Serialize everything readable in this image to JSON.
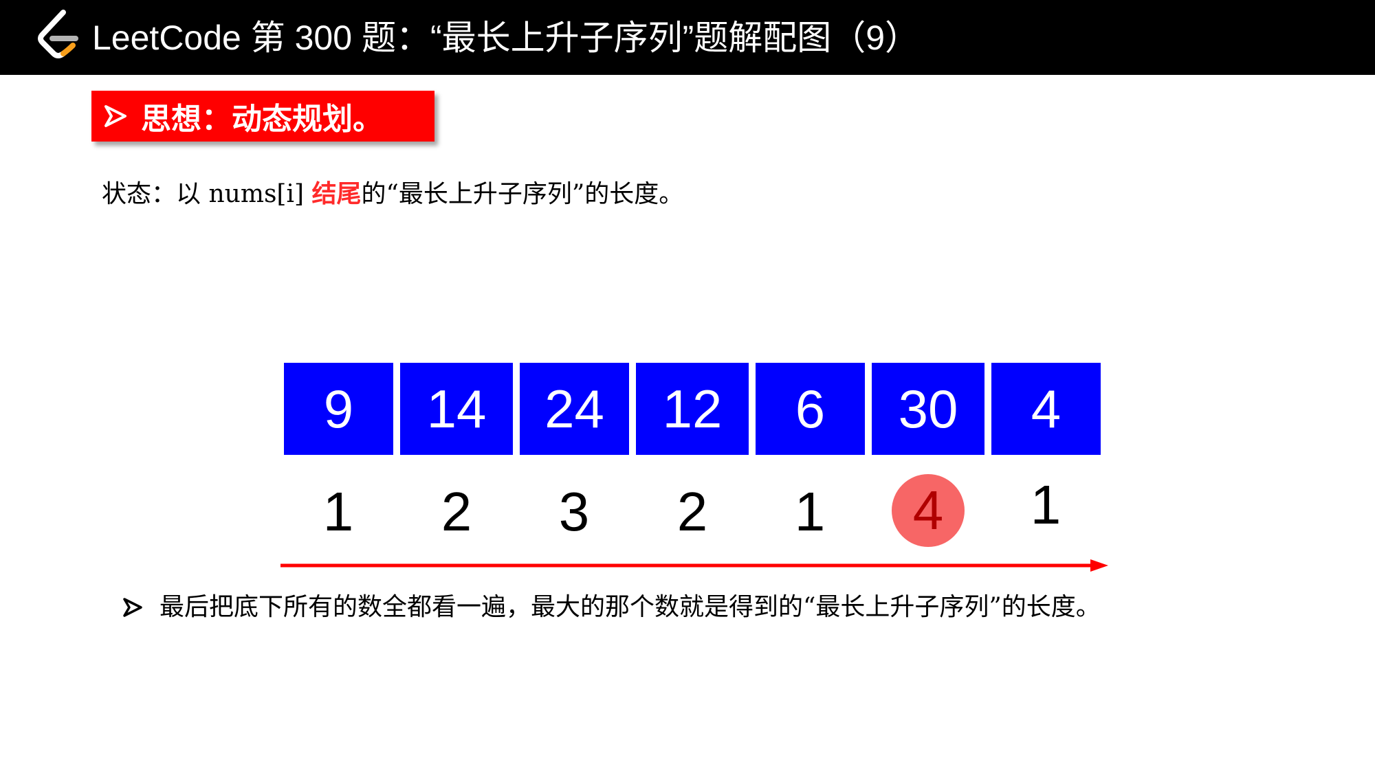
{
  "header": {
    "title": "LeetCode 第 300 题：“最长上升子序列”题解配图（9）",
    "logo_icon": "leetcode-logo-icon",
    "background": "#000000"
  },
  "idea": {
    "bullet_icon": "arrowhead-bullet-icon",
    "text": "思想：动态规划。",
    "background": "#ff0000"
  },
  "state": {
    "prefix": "状态：以 nums[i] ",
    "highlight": "结尾",
    "suffix": "的“最长上升子序列”的长度。",
    "highlight_color": "#ff2a2a"
  },
  "array": {
    "nums": [
      "9",
      "14",
      "24",
      "12",
      "6",
      "30",
      "4"
    ],
    "dp": [
      "1",
      "2",
      "3",
      "2",
      "1",
      "4",
      "1"
    ],
    "max_index": 5,
    "cell_color": "#0000ff",
    "highlight_circle_color": "#f76666",
    "highlight_text_color": "#b00000",
    "arrow_color": "#ff0000",
    "arrow_direction": "left-to-right"
  },
  "conclusion": {
    "bullet_icon": "arrowhead-bullet-icon",
    "text": "最后把底下所有的数全都看一遍，最大的那个数就是得到的“最长上升子序列”的长度。"
  }
}
